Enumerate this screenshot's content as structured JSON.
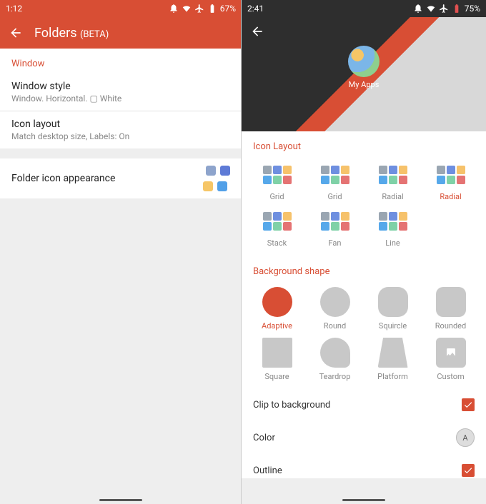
{
  "left": {
    "status": {
      "time": "1:12",
      "battery": "67%"
    },
    "title": "Folders",
    "title_suffix": "(BETA)",
    "section_window": "Window",
    "window_style": {
      "title": "Window style",
      "sub": "Window.  Horizontal.  ▢ White"
    },
    "icon_layout": {
      "title": "Icon layout",
      "sub": "Match desktop size, Labels: On"
    },
    "folder_icon": {
      "title": "Folder icon appearance"
    }
  },
  "right": {
    "status": {
      "time": "2:41",
      "battery": "75%"
    },
    "preview_label": "My Apps",
    "icon_layout_label": "Icon Layout",
    "icon_layouts": [
      {
        "name": "Grid",
        "selected": false
      },
      {
        "name": "Grid",
        "selected": false
      },
      {
        "name": "Radial",
        "selected": false
      },
      {
        "name": "Radial",
        "selected": true
      },
      {
        "name": "Stack",
        "selected": false
      },
      {
        "name": "Fan",
        "selected": false
      },
      {
        "name": "Line",
        "selected": false
      }
    ],
    "bg_shape_label": "Background shape",
    "shapes": [
      {
        "name": "Adaptive",
        "cls": "sh-adaptive",
        "selected": true
      },
      {
        "name": "Round",
        "cls": "sh-circle"
      },
      {
        "name": "Squircle",
        "cls": "sh-squircle"
      },
      {
        "name": "Rounded",
        "cls": "sh-rounded"
      },
      {
        "name": "Square",
        "cls": "sh-square"
      },
      {
        "name": "Teardrop",
        "cls": "sh-teardrop"
      },
      {
        "name": "Platform",
        "cls": "sh-platform"
      },
      {
        "name": "Custom",
        "cls": "sh-custom"
      }
    ],
    "clip_label": "Clip to background",
    "color_label": "Color",
    "color_value": "A",
    "outline_label": "Outline"
  }
}
